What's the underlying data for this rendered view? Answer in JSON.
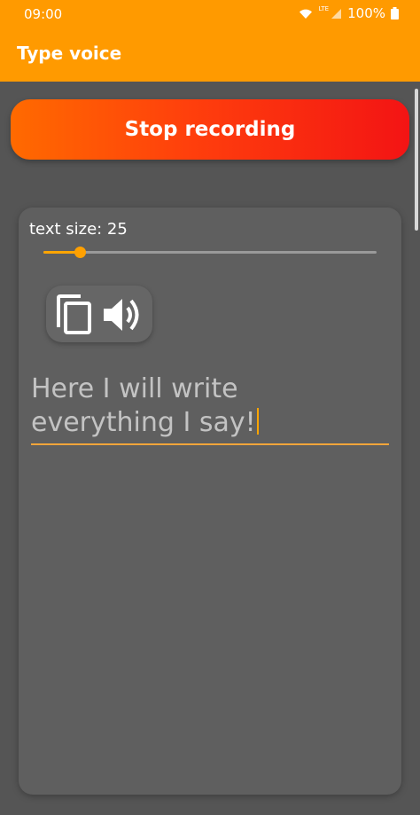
{
  "status_bar": {
    "time": "09:00",
    "network": "LTE",
    "battery": "100%"
  },
  "app_bar": {
    "title": "Type voice"
  },
  "record_button": {
    "label": "Stop recording"
  },
  "text_size": {
    "label": "text size: 25",
    "value_fraction": 0.11
  },
  "tools": {
    "copy_icon": "copy-icon",
    "speak_icon": "speaker-icon"
  },
  "editor": {
    "text": "Here I will write everything I say!"
  },
  "colors": {
    "app_bar": "#ff9a00",
    "background": "#555555",
    "card": "#5f5f5f",
    "accent": "#ffa500",
    "button_start": "#ff6a00",
    "button_end": "#f31414"
  }
}
